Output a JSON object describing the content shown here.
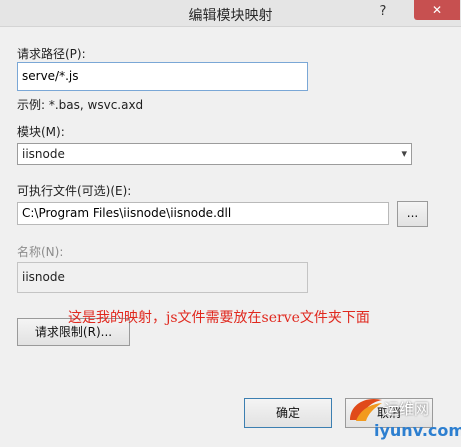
{
  "window": {
    "title": "编辑模块映射",
    "help_glyph": "?",
    "close_glyph": "✕"
  },
  "request_path": {
    "label": "请求路径(P):",
    "value": "serve/*.js",
    "example": "示例: *.bas, wsvc.axd"
  },
  "module": {
    "label": "模块(M):",
    "value": "iisnode"
  },
  "executable": {
    "label": "可执行文件(可选)(E):",
    "value": "C:\\Program Files\\iisnode\\iisnode.dll",
    "browse_label": "..."
  },
  "name": {
    "label": "名称(N):",
    "value": "iisnode"
  },
  "restrictions_button": "请求限制(R)...",
  "annotation": "这是我的映射，js文件需要放在serve文件夹下面",
  "buttons": {
    "ok": "确定",
    "cancel": "取消"
  },
  "watermark": {
    "line1": "运维网",
    "line2": "iyunv.com"
  }
}
